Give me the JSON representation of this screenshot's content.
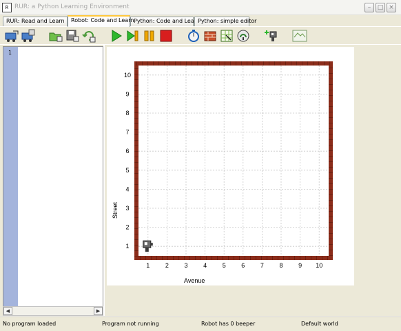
{
  "window": {
    "title": "RUR: a Python Learning Environment",
    "controls": [
      "minimize",
      "maximize",
      "close"
    ]
  },
  "tabs": [
    {
      "label": "RUR: Read and Learn",
      "active": false
    },
    {
      "label": "Robot: Code and Learn",
      "active": true
    },
    {
      "label": "Python: Code and Learn",
      "active": false
    },
    {
      "label": "Python: simple editor",
      "active": false
    }
  ],
  "toolbar": {
    "buttons": [
      {
        "name": "open-world",
        "icon": "open-world-icon"
      },
      {
        "name": "save-world",
        "icon": "save-world-icon"
      },
      {
        "name": "open-program",
        "icon": "open-folder-icon"
      },
      {
        "name": "save-program",
        "icon": "save-disk-icon"
      },
      {
        "name": "reset-world",
        "icon": "reset-icon"
      },
      {
        "name": "run",
        "icon": "play-icon"
      },
      {
        "name": "step",
        "icon": "step-icon"
      },
      {
        "name": "pause",
        "icon": "pause-icon"
      },
      {
        "name": "stop",
        "icon": "stop-icon"
      },
      {
        "name": "speed",
        "icon": "stopwatch-icon"
      },
      {
        "name": "edit-walls",
        "icon": "bricks-icon"
      },
      {
        "name": "resize-world",
        "icon": "resize-icon"
      },
      {
        "name": "beepers",
        "icon": "beeper-icon"
      },
      {
        "name": "robot-settings",
        "icon": "robot-icon"
      },
      {
        "name": "world-builder",
        "icon": "world-builder-icon"
      }
    ]
  },
  "editor": {
    "line_numbers": [
      "1"
    ],
    "content": ""
  },
  "world": {
    "x_axis_label": "Avenue",
    "y_axis_label": "Street",
    "avenues": [
      "1",
      "2",
      "3",
      "4",
      "5",
      "6",
      "7",
      "8",
      "9",
      "10"
    ],
    "streets": [
      "1",
      "2",
      "3",
      "4",
      "5",
      "6",
      "7",
      "8",
      "9",
      "10"
    ],
    "robot": {
      "avenue": 1,
      "street": 1,
      "facing": "east"
    },
    "wall_color": "#8b2c1a",
    "grid_color": "#c8c8c8"
  },
  "status": {
    "program": "No program loaded",
    "running": "Program not running",
    "beepers": "Robot has 0 beeper",
    "world": "Default world"
  },
  "colors": {
    "chrome": "#ece9d8",
    "gutter": "#a4b4dc",
    "active_tab_accent": "#ffc83c"
  }
}
